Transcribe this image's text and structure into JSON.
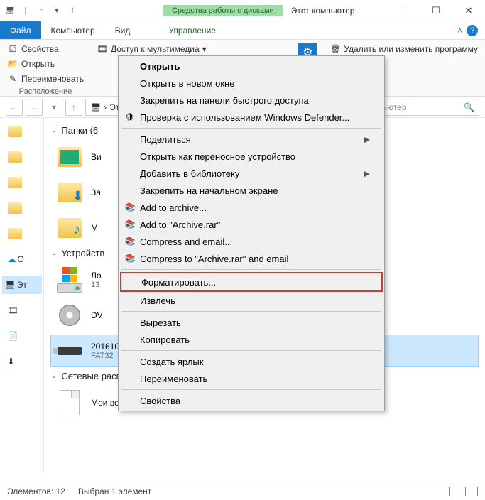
{
  "title": "Этот компьютер",
  "context_tab_header": "Средства работы с дисками",
  "context_tab_label": "Управление",
  "tabs": {
    "file": "Файл",
    "computer": "Компьютер",
    "view": "Вид"
  },
  "ribbon": {
    "properties": "Свойства",
    "open": "Открыть",
    "rename": "Переименовать",
    "group1_label": "Расположение",
    "media_access": "Доступ к мультимедиа",
    "remove_change": "Удалить или изменить программу"
  },
  "address": {
    "crumb": "Эт",
    "crumb_full": "Этот компьютер"
  },
  "search": {
    "placeholder": "компьютер"
  },
  "nav": {
    "selected": "Эт"
  },
  "groups": {
    "folders": "Папки (6",
    "devices": "Устройств",
    "network": "Сетевые расположения (1)"
  },
  "folders": [
    {
      "name": "Ви"
    },
    {
      "name": "За"
    },
    {
      "name": "М"
    }
  ],
  "devices": [
    {
      "name": "Ло",
      "sub": "13"
    },
    {
      "name": "DV",
      "sub": ""
    },
    {
      "name": "20161022_10 (G:)",
      "sub": "FAT32"
    }
  ],
  "network_item": "Мои веб-узлы MSN",
  "context_menu": {
    "open": "Открыть",
    "open_new": "Открыть в новом окне",
    "pin_quick": "Закрепить на панели быстрого доступа",
    "defender": "Проверка с использованием Windows Defender...",
    "share": "Поделиться",
    "portable": "Открыть как переносное устройство",
    "library": "Добавить в библиотеку",
    "pin_start": "Закрепить на начальном экране",
    "add_archive": "Add to archive...",
    "add_rar": "Add to \"Archive.rar\"",
    "compress_email": "Compress and email...",
    "compress_rar_email": "Compress to \"Archive.rar\" and email",
    "format": "Форматировать...",
    "eject": "Извлечь",
    "cut": "Вырезать",
    "copy": "Копировать",
    "shortcut": "Создать ярлык",
    "rename": "Переименовать",
    "props": "Свойства"
  },
  "status": {
    "elements": "Элементов: 12",
    "selected": "Выбран 1 элемент"
  }
}
